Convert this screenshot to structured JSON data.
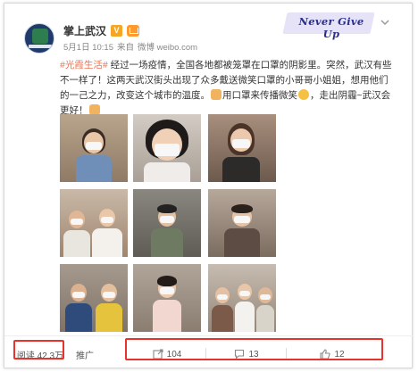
{
  "post": {
    "author": "掌上武汉",
    "verified_badge": "V",
    "timestamp": "5月1日 10:15",
    "source_prefix": "来自",
    "source": "微博 weibo.com",
    "hashtag": "#光霞生活#",
    "text_part1": " 经过一场疫情，全国各地都被笼罩在口罩的阴影里。突然，武汉有些不一样了！这两天武汉街头出现了众多戴送微笑口罩的小哥哥小姐姐，想用他们的一己之力，改变这个城市的温度。",
    "text_part2": "用口罩来传播微笑",
    "text_part3": "，走出阴霾~武汉会更好！",
    "photo_count": 9
  },
  "banner": {
    "text": "Never Give Up"
  },
  "footer": {
    "reads_label": "阅读 42.3万",
    "promote_label": "推广",
    "repost_count": "104",
    "comment_count": "13",
    "like_count": "12"
  },
  "colors": {
    "hashtag": "#eb7350",
    "highlight": "#e8332a",
    "banner_bg": "#e6e3f8",
    "banner_text": "#2b2f8a"
  },
  "icons": [
    "chevron-down-icon",
    "repost-icon",
    "comment-icon",
    "like-icon",
    "avatar"
  ]
}
